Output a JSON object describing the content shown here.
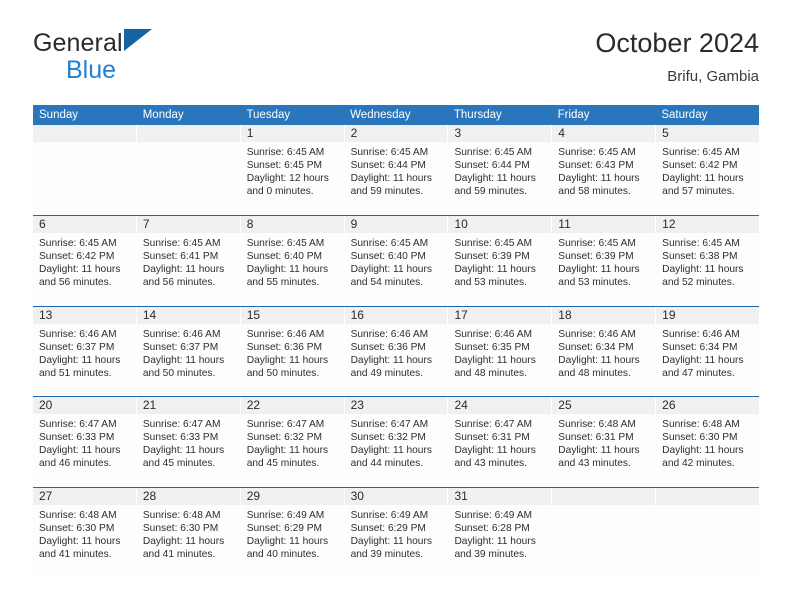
{
  "brand": {
    "name_top": "General",
    "name_bottom": "Blue",
    "triangle_color": "#1464a5",
    "blue_color": "#1f7fd0"
  },
  "header": {
    "title": "October 2024",
    "subtitle": "Brifu, Gambia"
  },
  "colors": {
    "header_bar": "#2a76bd",
    "week_separator": "#1f68ad",
    "daynum_band": "#f0f0f0"
  },
  "weekdays": [
    "Sunday",
    "Monday",
    "Tuesday",
    "Wednesday",
    "Thursday",
    "Friday",
    "Saturday"
  ],
  "weeks": [
    [
      {
        "day": "",
        "sunrise": "",
        "sunset": "",
        "daylight_line1": "",
        "daylight_line2": ""
      },
      {
        "day": "",
        "sunrise": "",
        "sunset": "",
        "daylight_line1": "",
        "daylight_line2": ""
      },
      {
        "day": "1",
        "sunrise": "Sunrise: 6:45 AM",
        "sunset": "Sunset: 6:45 PM",
        "daylight_line1": "Daylight: 12 hours",
        "daylight_line2": "and 0 minutes."
      },
      {
        "day": "2",
        "sunrise": "Sunrise: 6:45 AM",
        "sunset": "Sunset: 6:44 PM",
        "daylight_line1": "Daylight: 11 hours",
        "daylight_line2": "and 59 minutes."
      },
      {
        "day": "3",
        "sunrise": "Sunrise: 6:45 AM",
        "sunset": "Sunset: 6:44 PM",
        "daylight_line1": "Daylight: 11 hours",
        "daylight_line2": "and 59 minutes."
      },
      {
        "day": "4",
        "sunrise": "Sunrise: 6:45 AM",
        "sunset": "Sunset: 6:43 PM",
        "daylight_line1": "Daylight: 11 hours",
        "daylight_line2": "and 58 minutes."
      },
      {
        "day": "5",
        "sunrise": "Sunrise: 6:45 AM",
        "sunset": "Sunset: 6:42 PM",
        "daylight_line1": "Daylight: 11 hours",
        "daylight_line2": "and 57 minutes."
      }
    ],
    [
      {
        "day": "6",
        "sunrise": "Sunrise: 6:45 AM",
        "sunset": "Sunset: 6:42 PM",
        "daylight_line1": "Daylight: 11 hours",
        "daylight_line2": "and 56 minutes."
      },
      {
        "day": "7",
        "sunrise": "Sunrise: 6:45 AM",
        "sunset": "Sunset: 6:41 PM",
        "daylight_line1": "Daylight: 11 hours",
        "daylight_line2": "and 56 minutes."
      },
      {
        "day": "8",
        "sunrise": "Sunrise: 6:45 AM",
        "sunset": "Sunset: 6:40 PM",
        "daylight_line1": "Daylight: 11 hours",
        "daylight_line2": "and 55 minutes."
      },
      {
        "day": "9",
        "sunrise": "Sunrise: 6:45 AM",
        "sunset": "Sunset: 6:40 PM",
        "daylight_line1": "Daylight: 11 hours",
        "daylight_line2": "and 54 minutes."
      },
      {
        "day": "10",
        "sunrise": "Sunrise: 6:45 AM",
        "sunset": "Sunset: 6:39 PM",
        "daylight_line1": "Daylight: 11 hours",
        "daylight_line2": "and 53 minutes."
      },
      {
        "day": "11",
        "sunrise": "Sunrise: 6:45 AM",
        "sunset": "Sunset: 6:39 PM",
        "daylight_line1": "Daylight: 11 hours",
        "daylight_line2": "and 53 minutes."
      },
      {
        "day": "12",
        "sunrise": "Sunrise: 6:45 AM",
        "sunset": "Sunset: 6:38 PM",
        "daylight_line1": "Daylight: 11 hours",
        "daylight_line2": "and 52 minutes."
      }
    ],
    [
      {
        "day": "13",
        "sunrise": "Sunrise: 6:46 AM",
        "sunset": "Sunset: 6:37 PM",
        "daylight_line1": "Daylight: 11 hours",
        "daylight_line2": "and 51 minutes."
      },
      {
        "day": "14",
        "sunrise": "Sunrise: 6:46 AM",
        "sunset": "Sunset: 6:37 PM",
        "daylight_line1": "Daylight: 11 hours",
        "daylight_line2": "and 50 minutes."
      },
      {
        "day": "15",
        "sunrise": "Sunrise: 6:46 AM",
        "sunset": "Sunset: 6:36 PM",
        "daylight_line1": "Daylight: 11 hours",
        "daylight_line2": "and 50 minutes."
      },
      {
        "day": "16",
        "sunrise": "Sunrise: 6:46 AM",
        "sunset": "Sunset: 6:36 PM",
        "daylight_line1": "Daylight: 11 hours",
        "daylight_line2": "and 49 minutes."
      },
      {
        "day": "17",
        "sunrise": "Sunrise: 6:46 AM",
        "sunset": "Sunset: 6:35 PM",
        "daylight_line1": "Daylight: 11 hours",
        "daylight_line2": "and 48 minutes."
      },
      {
        "day": "18",
        "sunrise": "Sunrise: 6:46 AM",
        "sunset": "Sunset: 6:34 PM",
        "daylight_line1": "Daylight: 11 hours",
        "daylight_line2": "and 48 minutes."
      },
      {
        "day": "19",
        "sunrise": "Sunrise: 6:46 AM",
        "sunset": "Sunset: 6:34 PM",
        "daylight_line1": "Daylight: 11 hours",
        "daylight_line2": "and 47 minutes."
      }
    ],
    [
      {
        "day": "20",
        "sunrise": "Sunrise: 6:47 AM",
        "sunset": "Sunset: 6:33 PM",
        "daylight_line1": "Daylight: 11 hours",
        "daylight_line2": "and 46 minutes."
      },
      {
        "day": "21",
        "sunrise": "Sunrise: 6:47 AM",
        "sunset": "Sunset: 6:33 PM",
        "daylight_line1": "Daylight: 11 hours",
        "daylight_line2": "and 45 minutes."
      },
      {
        "day": "22",
        "sunrise": "Sunrise: 6:47 AM",
        "sunset": "Sunset: 6:32 PM",
        "daylight_line1": "Daylight: 11 hours",
        "daylight_line2": "and 45 minutes."
      },
      {
        "day": "23",
        "sunrise": "Sunrise: 6:47 AM",
        "sunset": "Sunset: 6:32 PM",
        "daylight_line1": "Daylight: 11 hours",
        "daylight_line2": "and 44 minutes."
      },
      {
        "day": "24",
        "sunrise": "Sunrise: 6:47 AM",
        "sunset": "Sunset: 6:31 PM",
        "daylight_line1": "Daylight: 11 hours",
        "daylight_line2": "and 43 minutes."
      },
      {
        "day": "25",
        "sunrise": "Sunrise: 6:48 AM",
        "sunset": "Sunset: 6:31 PM",
        "daylight_line1": "Daylight: 11 hours",
        "daylight_line2": "and 43 minutes."
      },
      {
        "day": "26",
        "sunrise": "Sunrise: 6:48 AM",
        "sunset": "Sunset: 6:30 PM",
        "daylight_line1": "Daylight: 11 hours",
        "daylight_line2": "and 42 minutes."
      }
    ],
    [
      {
        "day": "27",
        "sunrise": "Sunrise: 6:48 AM",
        "sunset": "Sunset: 6:30 PM",
        "daylight_line1": "Daylight: 11 hours",
        "daylight_line2": "and 41 minutes."
      },
      {
        "day": "28",
        "sunrise": "Sunrise: 6:48 AM",
        "sunset": "Sunset: 6:30 PM",
        "daylight_line1": "Daylight: 11 hours",
        "daylight_line2": "and 41 minutes."
      },
      {
        "day": "29",
        "sunrise": "Sunrise: 6:49 AM",
        "sunset": "Sunset: 6:29 PM",
        "daylight_line1": "Daylight: 11 hours",
        "daylight_line2": "and 40 minutes."
      },
      {
        "day": "30",
        "sunrise": "Sunrise: 6:49 AM",
        "sunset": "Sunset: 6:29 PM",
        "daylight_line1": "Daylight: 11 hours",
        "daylight_line2": "and 39 minutes."
      },
      {
        "day": "31",
        "sunrise": "Sunrise: 6:49 AM",
        "sunset": "Sunset: 6:28 PM",
        "daylight_line1": "Daylight: 11 hours",
        "daylight_line2": "and 39 minutes."
      },
      {
        "day": "",
        "sunrise": "",
        "sunset": "",
        "daylight_line1": "",
        "daylight_line2": ""
      },
      {
        "day": "",
        "sunrise": "",
        "sunset": "",
        "daylight_line1": "",
        "daylight_line2": ""
      }
    ]
  ]
}
